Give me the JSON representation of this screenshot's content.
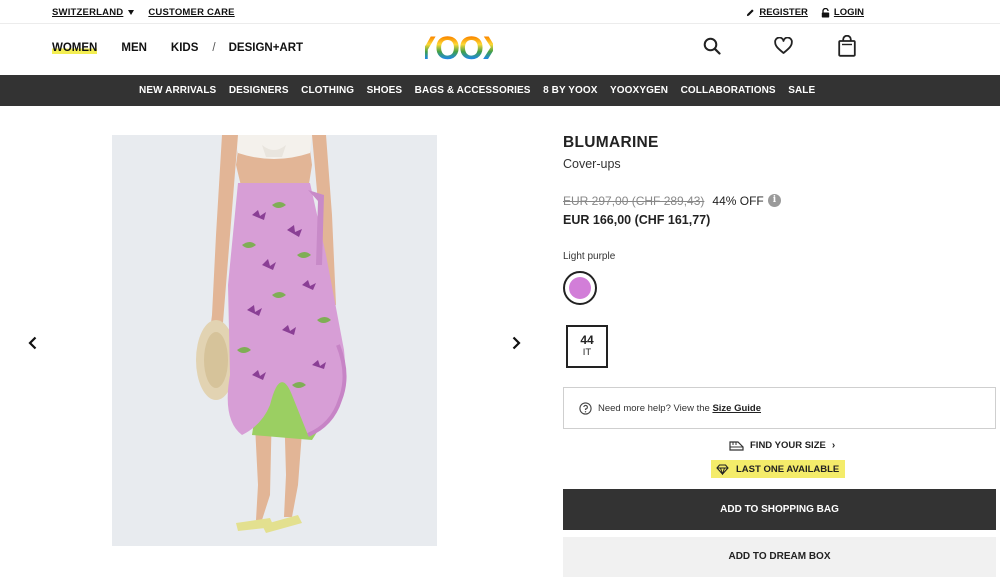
{
  "topbar": {
    "country": "SWITZERLAND",
    "customer_care": "CUSTOMER CARE",
    "register": "REGISTER",
    "login": "LOGIN"
  },
  "header": {
    "nav": [
      "WOMEN",
      "MEN",
      "KIDS",
      "DESIGN+ART"
    ],
    "separator": "/",
    "logo_text": "YOOX",
    "icons": [
      "search-icon",
      "heart-icon",
      "shopping-bag-icon"
    ]
  },
  "categories": [
    "NEW ARRIVALS",
    "DESIGNERS",
    "CLOTHING",
    "SHOES",
    "BAGS & ACCESSORIES",
    "8 BY YOOX",
    "YOOXYGEN",
    "COLLABORATIONS",
    "SALE"
  ],
  "product": {
    "brand": "BLUMARINE",
    "category": "Cover-ups",
    "price_old": "EUR 297,00 (CHF 289,43)",
    "discount": "44% OFF",
    "price_new": "EUR 166,00 (CHF 161,77)",
    "color_name": "Light purple",
    "swatch_color": "#d27ed8",
    "size": "44",
    "size_system": "IT"
  },
  "help": {
    "text": "Need more help? View the",
    "link": "Size Guide"
  },
  "find_size": "FIND YOUR SIZE",
  "stock_badge": "LAST ONE AVAILABLE",
  "buttons": {
    "add_to_bag": "ADD TO SHOPPING BAG",
    "add_to_dream": "ADD TO DREAM BOX"
  },
  "colors": {
    "accent_yellow": "#f3ee52",
    "dark_bar": "#333333"
  }
}
